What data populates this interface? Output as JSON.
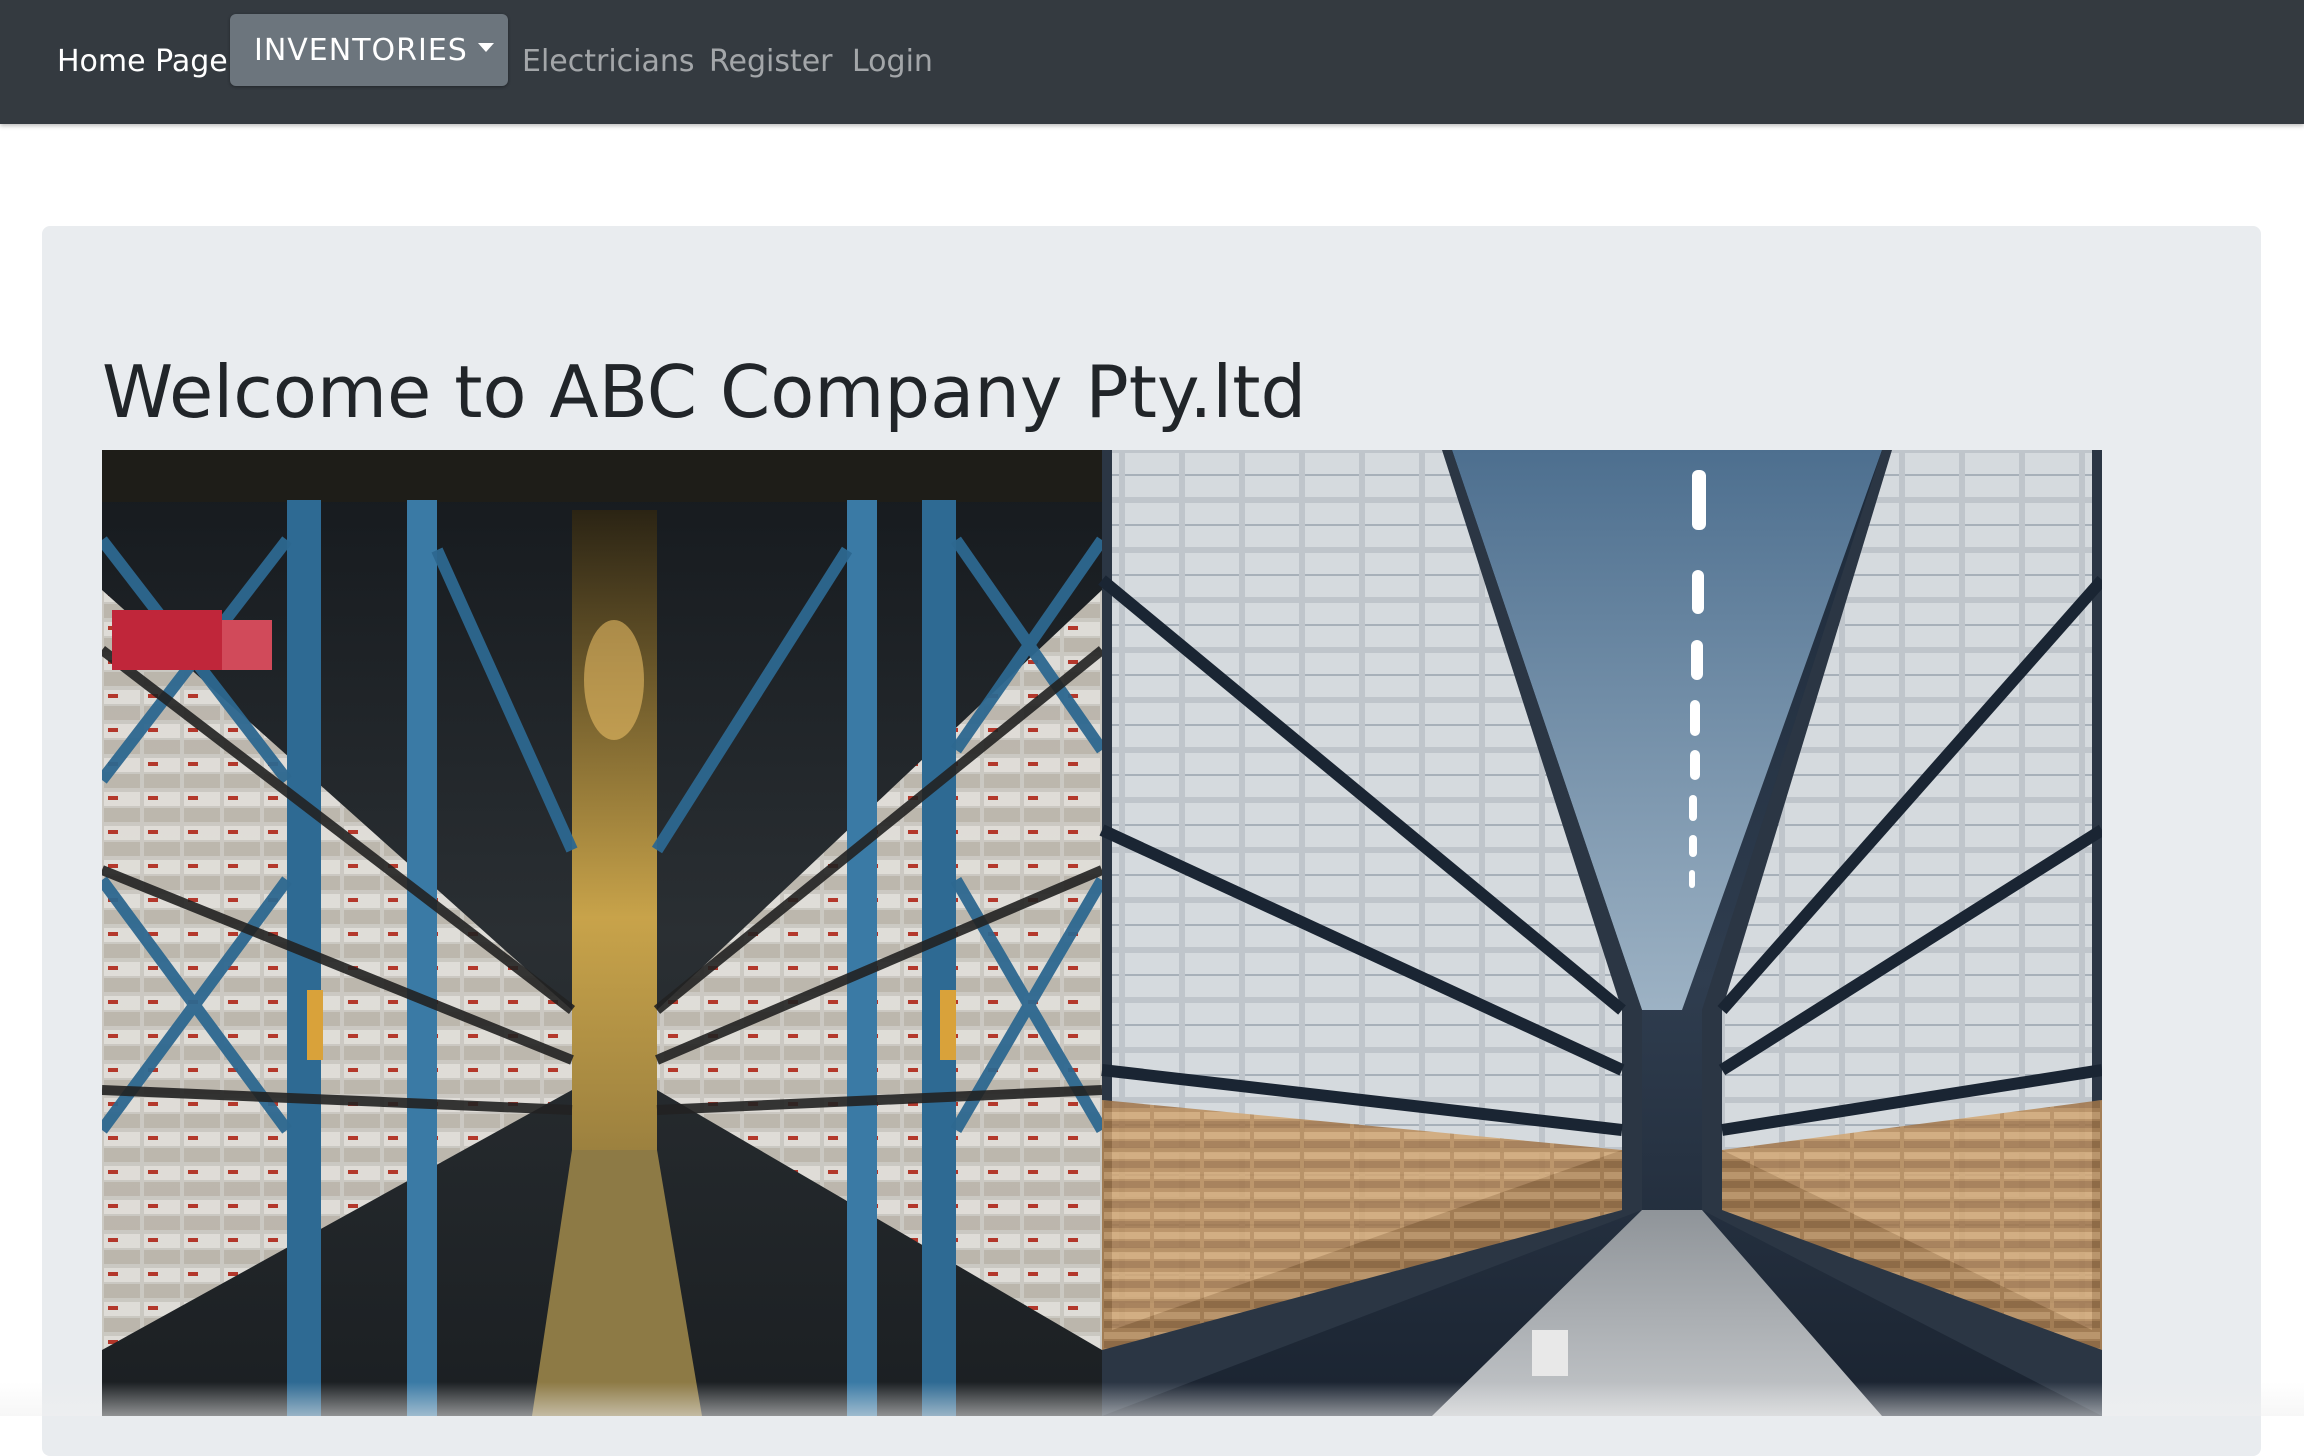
{
  "nav": {
    "home": "Home Page",
    "inventories": "INVENTORIES",
    "electricians": "Electricians",
    "register": "Register",
    "login": "Login"
  },
  "main": {
    "title": "Welcome to ABC Company Pty.ltd"
  },
  "colors": {
    "navbar": "#343a40",
    "dropdown": "#6c757d",
    "jumbotron": "#e9ecef",
    "title_text": "#212529"
  }
}
